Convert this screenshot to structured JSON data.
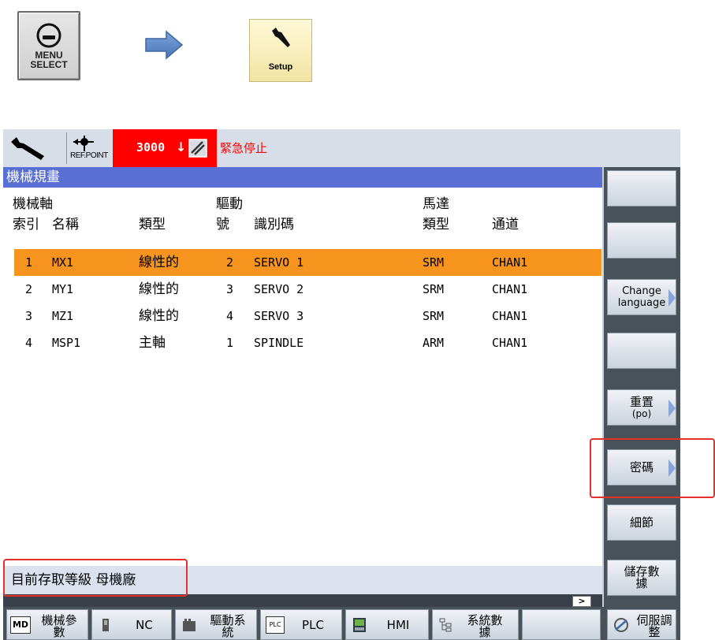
{
  "instruction": {
    "menu_select_key": {
      "line1": "MENU",
      "line2": "SELECT"
    },
    "arrow_icon": "right-arrow-icon",
    "setup_key": {
      "label": "Setup",
      "icon": "wrench-icon"
    }
  },
  "status_bar": {
    "refpoint_label": "REF.POINT",
    "alarm_number": "3000",
    "alarm_text": "緊急停止",
    "alarm_color": "#ff0000"
  },
  "title": "機械規畫",
  "table": {
    "headers": {
      "index_top": "機械軸",
      "index": "索引",
      "name": "名稱",
      "type": "類型",
      "drive_top": "驅動",
      "drive_no": "號",
      "identifier": "識別碼",
      "motor_top": "馬達",
      "motor_type": "類型",
      "channel": "通道"
    },
    "rows": [
      {
        "index": "1",
        "name": "MX1",
        "type": "線性的",
        "drive": "2",
        "id": "SERVO 1",
        "motor": "SRM",
        "channel": "CHAN1"
      },
      {
        "index": "2",
        "name": "MY1",
        "type": "線性的",
        "drive": "3",
        "id": "SERVO 2",
        "motor": "SRM",
        "channel": "CHAN1"
      },
      {
        "index": "3",
        "name": "MZ1",
        "type": "線性的",
        "drive": "4",
        "id": "SERVO 3",
        "motor": "SRM",
        "channel": "CHAN1"
      },
      {
        "index": "4",
        "name": "MSP1",
        "type": "主軸",
        "drive": "1",
        "id": "SPINDLE",
        "motor": "ARM",
        "channel": "CHAN1"
      }
    ],
    "selected_row_color": "#f7941d"
  },
  "access_level": "目前存取等級 母機廠",
  "scroll_button": ">",
  "vertical_softkeys": [
    {
      "label": ""
    },
    {
      "label": ""
    },
    {
      "label": "Change language"
    },
    {
      "label": ""
    },
    {
      "label": "重置",
      "sub": "(po)"
    },
    {
      "label": "密碼"
    },
    {
      "label": "細節"
    },
    {
      "label": "儲存數據"
    }
  ],
  "horizontal_softkeys": [
    {
      "icon": "md-icon",
      "icon_text": "MD",
      "label": "機械參數"
    },
    {
      "icon": "nc-icon",
      "label": "NC"
    },
    {
      "icon": "drive-icon",
      "label": "驅動系統"
    },
    {
      "icon": "plc-icon",
      "icon_text": "PLC",
      "label": "PLC"
    },
    {
      "icon": "hmi-icon",
      "label": "HMI"
    },
    {
      "icon": "tree-icon",
      "label": "系統數據"
    },
    {
      "icon": "",
      "label": ""
    },
    {
      "icon": "servo-icon",
      "label": "伺服調整"
    }
  ],
  "highlight_color": "#e4322b"
}
